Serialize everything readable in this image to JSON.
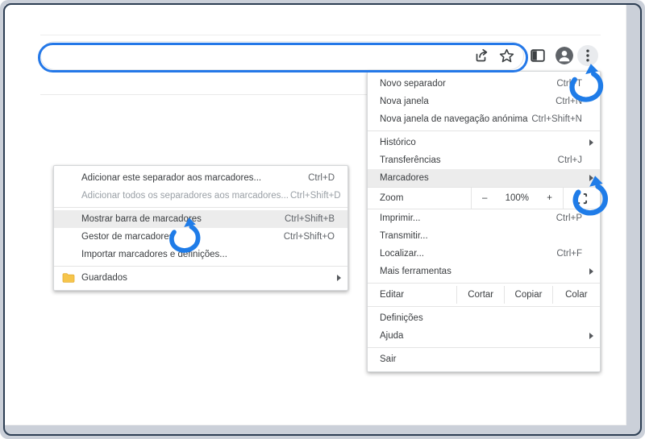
{
  "colors": {
    "annotation_blue": "#1f7ce8",
    "frame_border": "#2d3e53",
    "canvas_background": "#cbd0d9",
    "menu_highlight": "#ececec",
    "menu_text": "#3a3d40",
    "shortcut_text": "#5f6368",
    "disabled_text": "#9aa0a6",
    "folder_yellow": "#f6c54b",
    "profile_gray": "#5f6368"
  },
  "toolbar": {
    "icons": [
      "share-icon",
      "star-icon",
      "side-panel-icon",
      "profile-icon",
      "menu-dots-icon"
    ],
    "address_bar_annotated": true
  },
  "main_menu": {
    "items": [
      {
        "label": "Novo separador",
        "shortcut": "Ctrl+T"
      },
      {
        "label": "Nova janela",
        "shortcut": "Ctrl+N"
      },
      {
        "label": "Nova janela de navegação anónima",
        "shortcut": "Ctrl+Shift+N"
      },
      {
        "label": "Histórico",
        "submenu": true
      },
      {
        "label": "Transferências",
        "shortcut": "Ctrl+J"
      },
      {
        "label": "Marcadores",
        "submenu": true,
        "highlighted": true
      },
      {
        "label": "Imprimir...",
        "shortcut": "Ctrl+P"
      },
      {
        "label": "Transmitir..."
      },
      {
        "label": "Localizar...",
        "shortcut": "Ctrl+F"
      },
      {
        "label": "Mais ferramentas",
        "submenu": true
      },
      {
        "label": "Definições"
      },
      {
        "label": "Ajuda",
        "submenu": true
      },
      {
        "label": "Sair"
      }
    ],
    "zoom_row": {
      "label": "Zoom",
      "zoom_out": "–",
      "zoom_level": "100%",
      "zoom_in": "+"
    },
    "edit_row": {
      "label": "Editar",
      "cut": "Cortar",
      "copy": "Copiar",
      "paste": "Colar"
    }
  },
  "bookmarks_submenu": {
    "items": [
      {
        "label": "Adicionar este separador aos marcadores...",
        "shortcut": "Ctrl+D"
      },
      {
        "label": "Adicionar todos os separadores aos marcadores...",
        "shortcut": "Ctrl+Shift+D",
        "disabled": true
      },
      {
        "label": "Mostrar barra de marcadores",
        "shortcut": "Ctrl+Shift+B",
        "highlighted": true
      },
      {
        "label": "Gestor de marcadores",
        "shortcut": "Ctrl+Shift+O"
      },
      {
        "label": "Importar marcadores e definições..."
      },
      {
        "label": "Guardados",
        "submenu": true,
        "folder": true
      }
    ]
  }
}
